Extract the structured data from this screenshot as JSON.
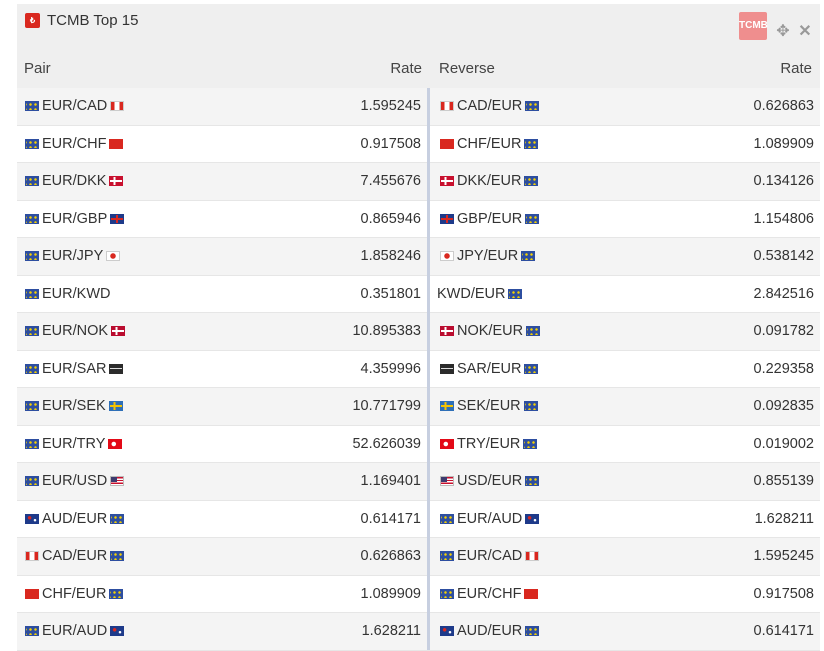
{
  "widget": {
    "title": "TCMB Top 15",
    "logo_text": "TCMB",
    "move_icon": "move-icon",
    "close_icon": "close-icon"
  },
  "headers": {
    "pair": "Pair",
    "rate": "Rate",
    "reverse": "Reverse",
    "reverse_rate": "Rate"
  },
  "rows": [
    {
      "pair": "EUR/CAD",
      "f1": "eu",
      "f2": "ca",
      "rate": "1.595245",
      "rev": "CAD/EUR",
      "r1": "ca",
      "r2": "eu",
      "rrate": "0.626863"
    },
    {
      "pair": "EUR/CHF",
      "f1": "eu",
      "f2": "ch",
      "rate": "0.917508",
      "rev": "CHF/EUR",
      "r1": "ch",
      "r2": "eu",
      "rrate": "1.089909"
    },
    {
      "pair": "EUR/DKK",
      "f1": "eu",
      "f2": "dk",
      "rate": "7.455676",
      "rev": "DKK/EUR",
      "r1": "dk",
      "r2": "eu",
      "rrate": "0.134126"
    },
    {
      "pair": "EUR/GBP",
      "f1": "eu",
      "f2": "gb",
      "rate": "0.865946",
      "rev": "GBP/EUR",
      "r1": "gb",
      "r2": "eu",
      "rrate": "1.154806"
    },
    {
      "pair": "EUR/JPY",
      "f1": "eu",
      "f2": "jp",
      "rate": "1.858246",
      "rev": "JPY/EUR",
      "r1": "jp",
      "r2": "eu",
      "rrate": "0.538142"
    },
    {
      "pair": "EUR/KWD",
      "f1": "eu",
      "f2": "none",
      "rate": "0.351801",
      "rev": "KWD/EUR",
      "r1": "none",
      "r2": "eu",
      "rrate": "2.842516"
    },
    {
      "pair": "EUR/NOK",
      "f1": "eu",
      "f2": "no",
      "rate": "10.895383",
      "rev": "NOK/EUR",
      "r1": "no",
      "r2": "eu",
      "rrate": "0.091782"
    },
    {
      "pair": "EUR/SAR",
      "f1": "eu",
      "f2": "sa",
      "rate": "4.359996",
      "rev": "SAR/EUR",
      "r1": "sa",
      "r2": "eu",
      "rrate": "0.229358"
    },
    {
      "pair": "EUR/SEK",
      "f1": "eu",
      "f2": "se",
      "rate": "10.771799",
      "rev": "SEK/EUR",
      "r1": "se",
      "r2": "eu",
      "rrate": "0.092835"
    },
    {
      "pair": "EUR/TRY",
      "f1": "eu",
      "f2": "tr",
      "rate": "52.626039",
      "rev": "TRY/EUR",
      "r1": "tr",
      "r2": "eu",
      "rrate": "0.019002"
    },
    {
      "pair": "EUR/USD",
      "f1": "eu",
      "f2": "us",
      "rate": "1.169401",
      "rev": "USD/EUR",
      "r1": "us",
      "r2": "eu",
      "rrate": "0.855139"
    },
    {
      "pair": "AUD/EUR",
      "f1": "au",
      "f2": "eu",
      "rate": "0.614171",
      "rev": "EUR/AUD",
      "r1": "eu",
      "r2": "au",
      "rrate": "1.628211"
    },
    {
      "pair": "CAD/EUR",
      "f1": "ca",
      "f2": "eu",
      "rate": "0.626863",
      "rev": "EUR/CAD",
      "r1": "eu",
      "r2": "ca",
      "rrate": "1.595245"
    },
    {
      "pair": "CHF/EUR",
      "f1": "ch",
      "f2": "eu",
      "rate": "1.089909",
      "rev": "EUR/CHF",
      "r1": "eu",
      "r2": "ch",
      "rrate": "0.917508"
    },
    {
      "pair": "EUR/AUD",
      "f1": "eu",
      "f2": "au",
      "rate": "1.628211",
      "rev": "AUD/EUR",
      "r1": "au",
      "r2": "eu",
      "rrate": "0.614171"
    }
  ]
}
